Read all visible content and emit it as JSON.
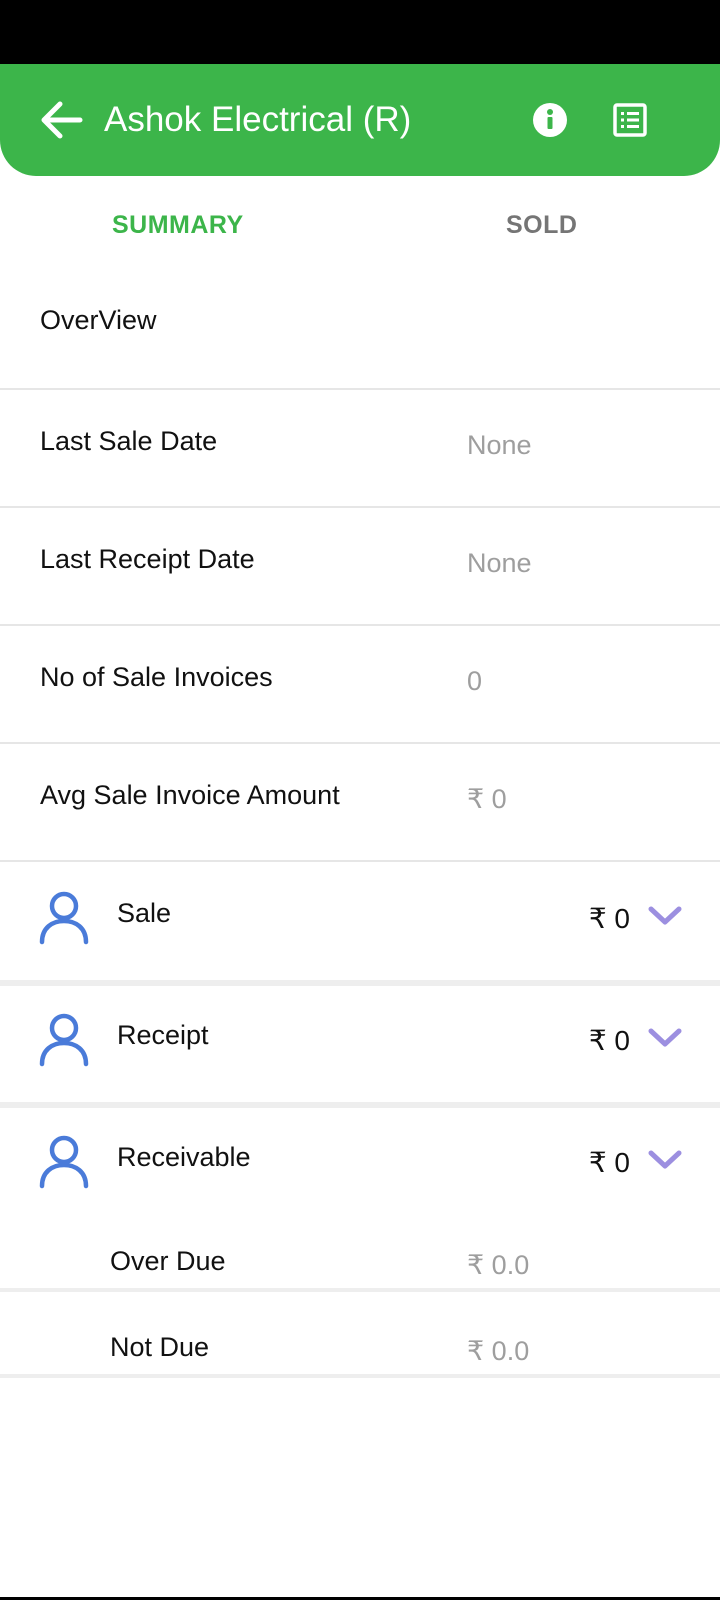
{
  "header": {
    "title": "Ashok Electrical (R)",
    "icons": {
      "back": "arrow-left-icon",
      "info": "info-icon",
      "report": "list-icon"
    }
  },
  "tabs": [
    {
      "label": "SUMMARY",
      "active": true
    },
    {
      "label": "SOLD",
      "active": false
    }
  ],
  "overview": {
    "title": "OverView",
    "rows": [
      {
        "label": "Last Sale Date",
        "value": "None"
      },
      {
        "label": "Last Receipt Date",
        "value": "None"
      },
      {
        "label": "No of Sale Invoices",
        "value": "0"
      },
      {
        "label": "Avg Sale Invoice Amount",
        "value": "₹ 0"
      }
    ]
  },
  "groups": [
    {
      "label": "Sale",
      "value": "₹ 0"
    },
    {
      "label": "Receipt",
      "value": "₹ 0"
    },
    {
      "label": "Receivable",
      "value": "₹ 0"
    }
  ],
  "receivable_details": [
    {
      "label": "Over Due",
      "value": "₹ 0.0"
    },
    {
      "label": "Not Due",
      "value": "₹ 0.0"
    }
  ],
  "colors": {
    "primary": "#3cb54a",
    "icon_blue": "#4a7bd9",
    "chevron": "#9c8fe0",
    "muted": "#9e9e9e"
  }
}
